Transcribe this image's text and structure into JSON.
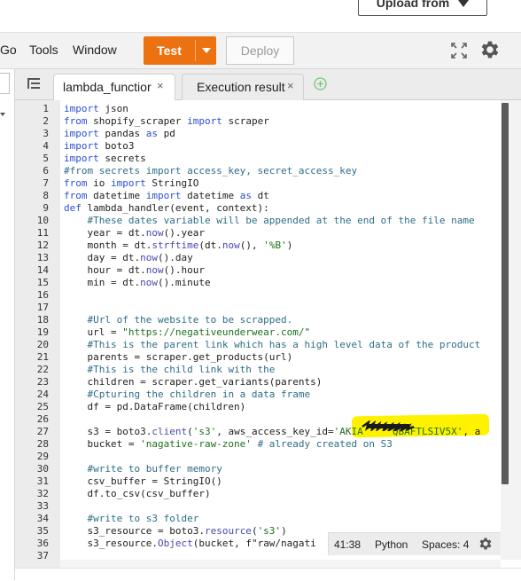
{
  "header": {
    "upload_label": "Upload from"
  },
  "toolbar": {
    "menus": [
      "Go",
      "Tools",
      "Window"
    ],
    "test_label": "Test",
    "deploy_label": "Deploy"
  },
  "tabs": [
    {
      "label": "lambda_functior",
      "active": true
    },
    {
      "label": "Execution results",
      "active": false
    }
  ],
  "editor": {
    "line_numbers": [
      "1",
      "2",
      "3",
      "4",
      "5",
      "6",
      "7",
      "8",
      "9",
      "10",
      "11",
      "12",
      "13",
      "14",
      "15",
      "16",
      "17",
      "18",
      "19",
      "20",
      "21",
      "22",
      "23",
      "24",
      "25",
      "26",
      "27",
      "28",
      "29",
      "30",
      "31",
      "32",
      "33",
      "34",
      "35",
      "36",
      "37"
    ],
    "lines": [
      "import json",
      "from shopify_scraper import scraper",
      "import pandas as pd",
      "import boto3",
      "import secrets",
      "#from secrets import access_key, secret_access_key",
      "from io import StringIO",
      "from datetime import datetime as dt",
      "def lambda_handler(event, context):",
      "    #These dates variable will be appended at the end of the file name",
      "    year = dt.now().year",
      "    month = dt.strftime(dt.now(), '%B')",
      "    day = dt.now().day",
      "    hour = dt.now().hour",
      "    min = dt.now().minute",
      "",
      "",
      "    #Url of the website to be scrapped.",
      "    url = \"https://negativeunderwear.com/\"",
      "    #This is the parent link which has a high level data of the product",
      "    parents = scraper.get_products(url)",
      "    #This is the child link with the",
      "    children = scraper.get_variants(parents)",
      "    #Cpturing the children in a data frame",
      "    df = pd.DataFrame(children)",
      "",
      "    s3 = boto3.client('s3', aws_access_key_id='AKIA     QBAFTLSIV5X', a",
      "    bucket = 'nagative-raw-zone' # already created on S3",
      "",
      "    #write to buffer memory",
      "    csv_buffer = StringIO()",
      "    df.to_csv(csv_buffer)",
      "",
      "    #write to s3 folder",
      "    s3_resource = boto3.resource('s3')",
      "    s3_resource.Object(bucket, f\"raw/nagati",
      ""
    ]
  },
  "status": {
    "cursor": "41:38",
    "language": "Python",
    "spaces": "Spaces: 4"
  },
  "colors": {
    "accent": "#ec7211",
    "highlight": "#fff200",
    "keyword": "#2b4fcf",
    "comment": "#2e6d87",
    "string": "#1f6f1f"
  }
}
